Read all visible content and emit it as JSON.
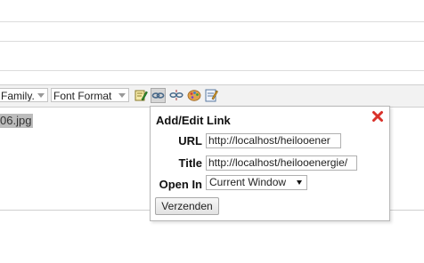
{
  "toolbar": {
    "font_family_label": "Family.",
    "font_format_label": "Font Format",
    "buttons": [
      "edit-icon",
      "link-icon",
      "unlink-icon",
      "palette-icon",
      "notepad-icon"
    ]
  },
  "editor": {
    "filename_text": "06.jpg"
  },
  "dialog": {
    "title": "Add/Edit Link",
    "url_label": "URL",
    "url_value": "http://localhost/heilooener",
    "title_label": "Title",
    "title_value": "http://localhost/heilooenergie/",
    "open_in_label": "Open In",
    "open_in_value": "Current Window",
    "submit_label": "Verzenden"
  },
  "colors": {
    "close_red": "#d9312a",
    "toolbar_bg": "#f2f2f2",
    "selection_bg": "#bcbcbc"
  }
}
